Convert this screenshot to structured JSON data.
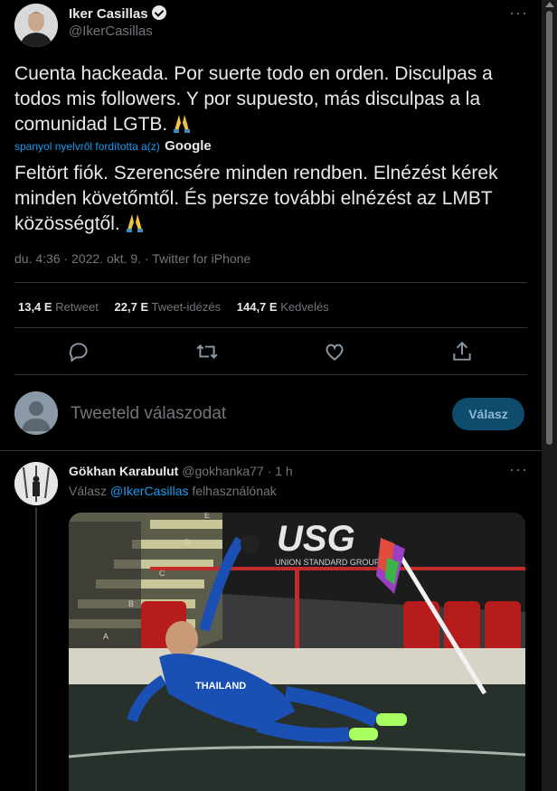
{
  "main_tweet": {
    "author_name": "Iker Casillas",
    "author_handle": "@IkerCasillas",
    "more": "···",
    "text": "Cuenta hackeada. Por suerte todo en orden. Disculpas a todos mis followers. Y por supuesto, más disculpas a la comunidad LGTB.",
    "translated_by": "spanyol nyelvről fordította a(z)",
    "translator": "Google",
    "translation": "Feltört fiók. Szerencsére minden rendben. Elnézést kérek minden követőmtől. És persze további elnézést az LMBT közösségtől.",
    "timestamp": "du. 4:36 · 2022. okt. 9. · Twitter for iPhone",
    "stats": [
      {
        "num": "13,4 E",
        "label": "Retweet"
      },
      {
        "num": "22,7 E",
        "label": "Tweet-idézés"
      },
      {
        "num": "144,7 E",
        "label": "Kedvelés"
      }
    ]
  },
  "reply_box": {
    "placeholder": "Tweeteld válaszodat",
    "button": "Válasz"
  },
  "reply_tweet": {
    "author_name": "Gökhan Karabulut",
    "author_handle": "@gokhanka77",
    "time": "1 h",
    "more": "···",
    "replying_prefix": "Válasz",
    "replying_to": "@IkerCasillas",
    "replying_suffix": "felhasználónak",
    "media_banner_text": "USG",
    "media_banner_sub": "UNION STANDARD GROUP",
    "media_player_name": "THAILAND",
    "media_stand_letters": [
      "E",
      "D",
      "C",
      "B",
      "A"
    ]
  },
  "colors": {
    "background": "#000000",
    "text": "#e7e9ea",
    "muted": "#71767b",
    "accent": "#1d9bf0",
    "divider": "#2f3336"
  },
  "icons": [
    "verified-badge-icon",
    "pray-emoji-icon",
    "reply-icon",
    "retweet-icon",
    "like-icon",
    "share-icon"
  ]
}
